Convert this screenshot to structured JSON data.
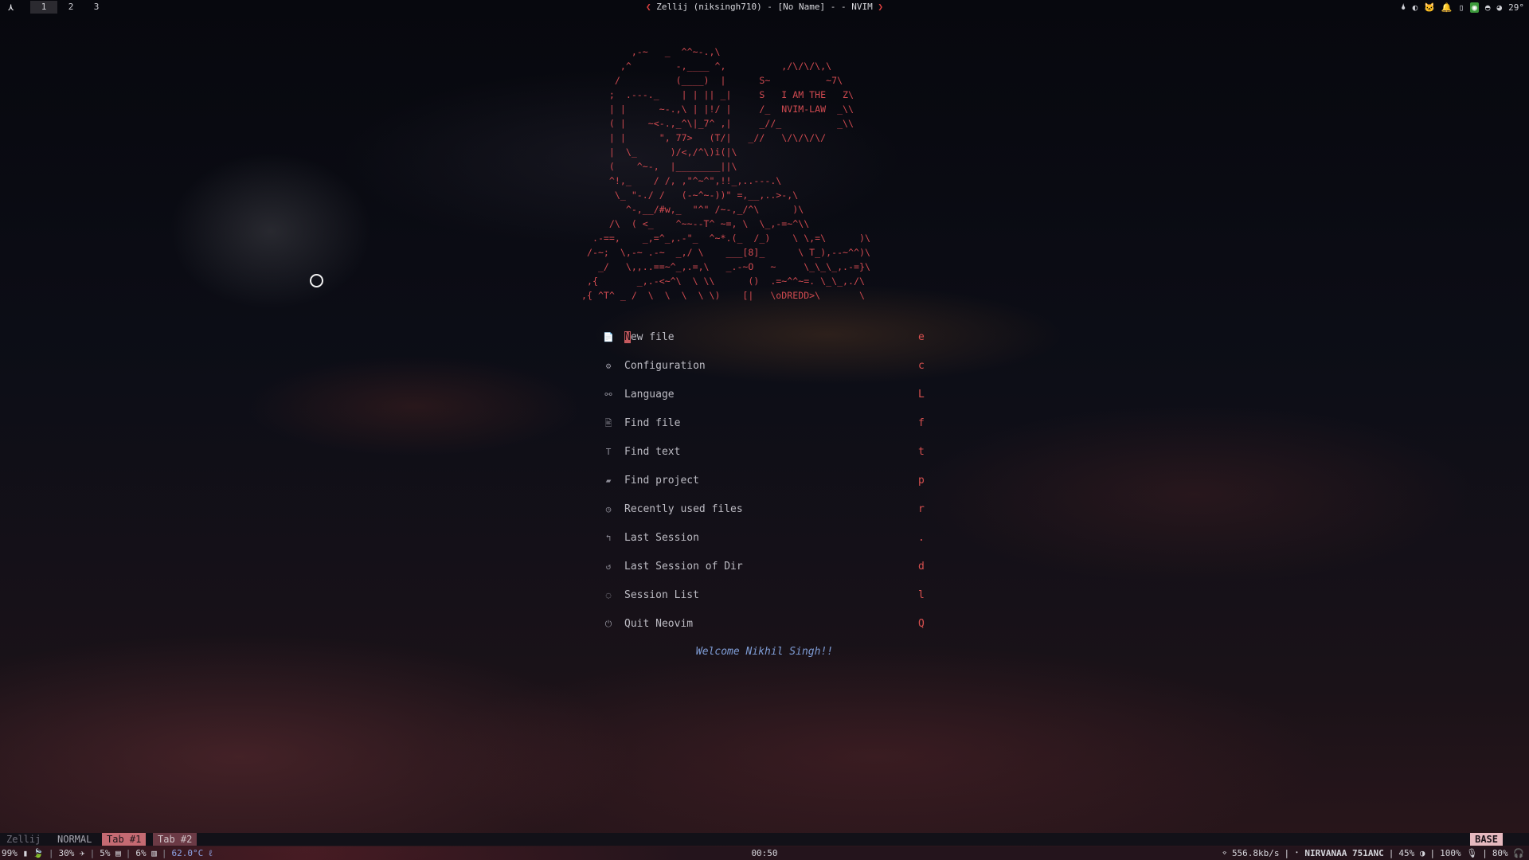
{
  "topbar": {
    "logo": "⋏",
    "workspaces": [
      "1",
      "2",
      "3"
    ],
    "active_workspace": "1",
    "title_left_chevron": "❮",
    "title": "Zellij (niksingh710) - [No Name] - - NVIM",
    "title_right_chevron": "❯",
    "tray": {
      "drop_icon": "🌢",
      "toggle_icon": "◐",
      "cat_icon": "🐱",
      "alert_icon": "🔔",
      "phone_icon": "▯",
      "app_icon": "◉",
      "discord_icon": "◓",
      "weather_icon": "◕",
      "temperature": "29°"
    }
  },
  "dashboard": {
    "ascii_art": "         ,-~   _  ^^~-.,\\\n       ,^        -,____ ^,          ,/\\/\\/\\,\\\n      /          (____)  |      S~          ~7\\\n     ;  .---._    | | || _|     S   I AM THE   Z\\\n     | |      ~-.,\\ | |!/ |     /_  NVIM-LAW  _\\\\\n     ( |    ~<-.,_^\\|_7^ ,|     _//_          _\\\\\n     | |      \", 77>   (T/|   _//   \\/\\/\\/\\/\n     |  \\_      )/<,/^\\)i(|\\\n     (    ^~-,  |________||\\\n     ^!,_    / /, ,\"^~^\",!!_,..---.\\\n      \\_ \"-./ /   (-~^~-))\" =,__,..>-,\\\n        ^-,__/#w,_  \"^\" /~-,_/^\\      )\\\n     /\\  ( <_    ^~~--T^ ~=, \\  \\_,-=~^\\\\\n  .-==,    _,=^_,.-\"_  ^~*.(_  /_)    \\ \\,=\\      )\\\n /-~;  \\,-~ .-~  _,/ \\    ___[8]_      \\ T_),--~^^)\\\n   _/   \\,,..==~^_,.=,\\   _.-~O   ~     \\_\\_\\_,.-=}\\\n ,{       _,.-<~^\\  \\ \\\\      ()  .=~^^~=. \\_\\_,./\\\n,{ ^T^ _ /  \\  \\  \\  \\ \\)    [|   \\oDREDD>\\       \\",
    "menu": [
      {
        "icon": "📄",
        "first": "N",
        "rest": "ew file",
        "key": "e"
      },
      {
        "icon": "⚙",
        "first": "",
        "rest": "Configuration",
        "key": "c"
      },
      {
        "icon": "⚯",
        "first": "",
        "rest": "Language",
        "key": "L"
      },
      {
        "icon": "🖹",
        "first": "",
        "rest": "Find file",
        "key": "f"
      },
      {
        "icon": "T",
        "first": "",
        "rest": "Find text",
        "key": "t"
      },
      {
        "icon": "▰",
        "first": "",
        "rest": "Find project",
        "key": "p"
      },
      {
        "icon": "◷",
        "first": "",
        "rest": "Recently used files",
        "key": "r"
      },
      {
        "icon": "↰",
        "first": "",
        "rest": "Last Session",
        "key": "."
      },
      {
        "icon": "↺",
        "first": "",
        "rest": "Last Session of Dir",
        "key": "d"
      },
      {
        "icon": "◌",
        "first": "",
        "rest": "Session List",
        "key": "l"
      },
      {
        "icon": "⏻",
        "first": "",
        "rest": "Quit Neovim",
        "key": "Q"
      }
    ],
    "welcome": "Welcome Nikhil Singh!!"
  },
  "zellij_bar": {
    "session": "Zellij",
    "mode": "NORMAL",
    "tabs": [
      "Tab #1",
      "Tab #2"
    ],
    "base": "BASE"
  },
  "statusbar": {
    "battery": "99% ▮",
    "leaf": "🍃",
    "cpu": "30% ✈",
    "mem": "5% ▤",
    "disk": "6% ▥",
    "temp": "62.0°C ℓ",
    "clock": "00:50",
    "wifi": "⌔",
    "net": "556.8kb/s",
    "bt": "᛫ NIRVANAA 751ANC",
    "brightness": "45% ◑",
    "mic": "100% 🎙",
    "volume": "80% 🎧"
  },
  "colors": {
    "accent_red": "#d04a50",
    "key_red": "#d9504f",
    "welcome_blue": "#7f9dd6",
    "tab_active": "#c46a72"
  }
}
